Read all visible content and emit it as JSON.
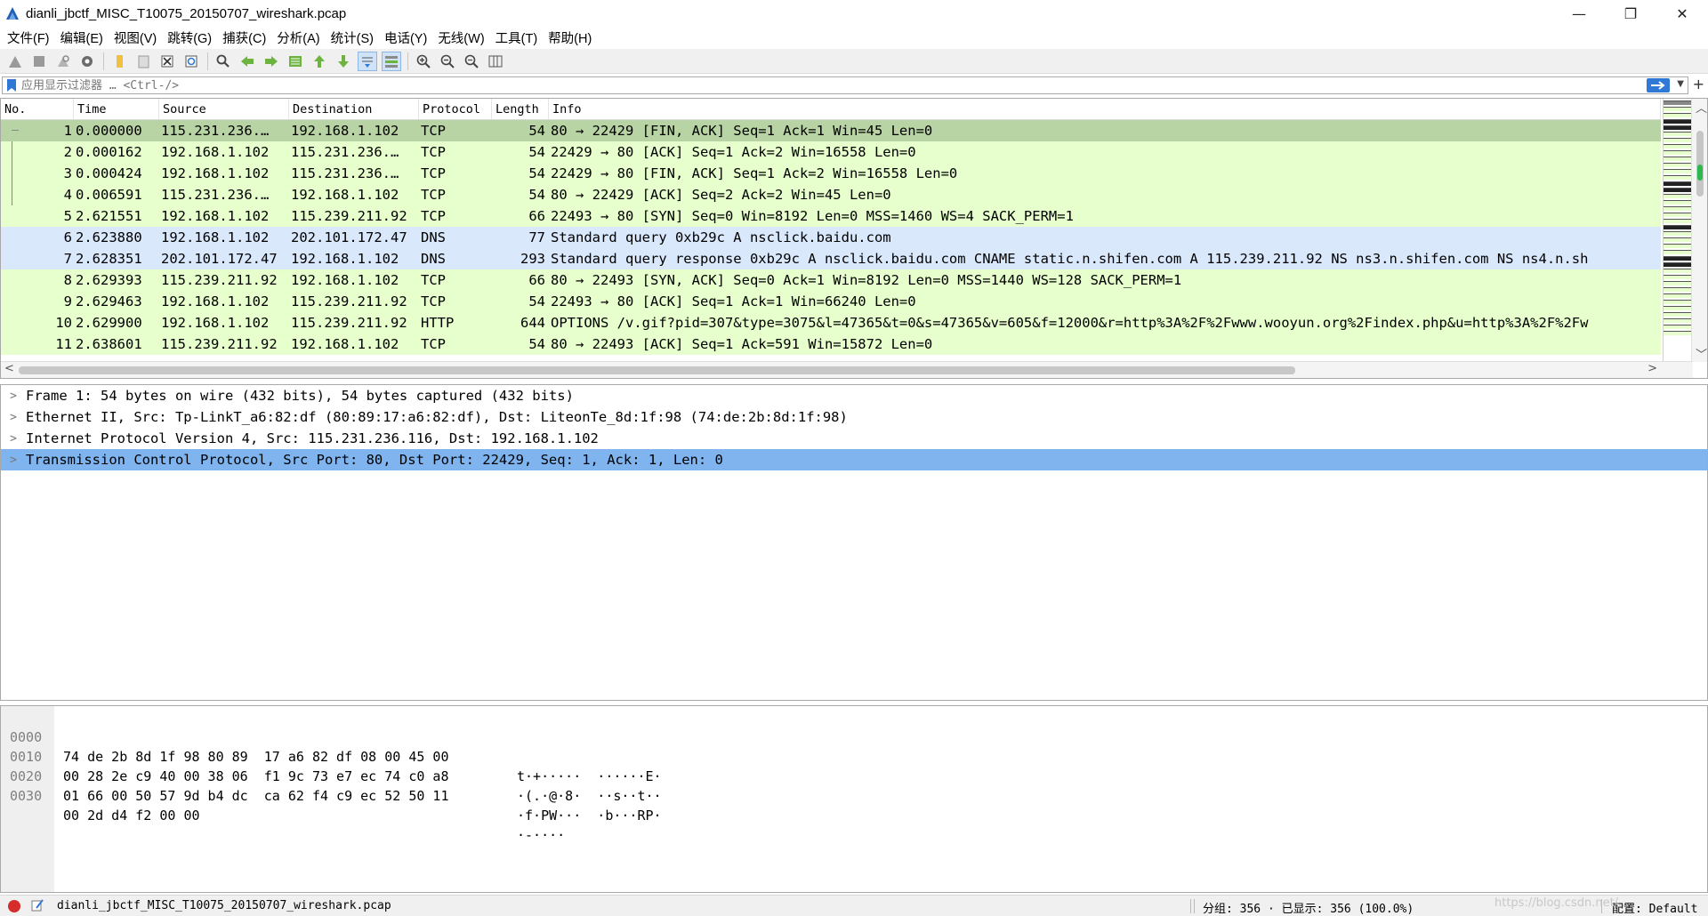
{
  "window": {
    "title": "dianli_jbctf_MISC_T10075_20150707_wireshark.pcap",
    "minimize": "—",
    "restore": "❐",
    "close": "✕"
  },
  "menu": [
    "文件(F)",
    "编辑(E)",
    "视图(V)",
    "跳转(G)",
    "捕获(C)",
    "分析(A)",
    "统计(S)",
    "电话(Y)",
    "无线(W)",
    "工具(T)",
    "帮助(H)"
  ],
  "filter": {
    "placeholder": "应用显示过滤器 … <Ctrl-/>",
    "plus": "+"
  },
  "packet_list": {
    "columns": [
      "No.",
      "Time",
      "Source",
      "Destination",
      "Protocol",
      "Length",
      "Info"
    ],
    "rows": [
      {
        "no": "1",
        "time": "0.000000",
        "src": "115.231.236.…",
        "dst": "192.168.1.102",
        "proto": "TCP",
        "len": "54",
        "info": "80 → 22429 [FIN, ACK] Seq=1 Ack=1 Win=45 Len=0",
        "type": "selected"
      },
      {
        "no": "2",
        "time": "0.000162",
        "src": "192.168.1.102",
        "dst": "115.231.236.…",
        "proto": "TCP",
        "len": "54",
        "info": "22429 → 80 [ACK] Seq=1 Ack=2 Win=16558 Len=0",
        "type": "tcp"
      },
      {
        "no": "3",
        "time": "0.000424",
        "src": "192.168.1.102",
        "dst": "115.231.236.…",
        "proto": "TCP",
        "len": "54",
        "info": "22429 → 80 [FIN, ACK] Seq=1 Ack=2 Win=16558 Len=0",
        "type": "tcp"
      },
      {
        "no": "4",
        "time": "0.006591",
        "src": "115.231.236.…",
        "dst": "192.168.1.102",
        "proto": "TCP",
        "len": "54",
        "info": "80 → 22429 [ACK] Seq=2 Ack=2 Win=45 Len=0",
        "type": "tcp"
      },
      {
        "no": "5",
        "time": "2.621551",
        "src": "192.168.1.102",
        "dst": "115.239.211.92",
        "proto": "TCP",
        "len": "66",
        "info": "22493 → 80 [SYN] Seq=0 Win=8192 Len=0 MSS=1460 WS=4 SACK_PERM=1",
        "type": "tcp"
      },
      {
        "no": "6",
        "time": "2.623880",
        "src": "192.168.1.102",
        "dst": "202.101.172.47",
        "proto": "DNS",
        "len": "77",
        "info": "Standard query 0xb29c A nsclick.baidu.com",
        "type": "dns"
      },
      {
        "no": "7",
        "time": "2.628351",
        "src": "202.101.172.47",
        "dst": "192.168.1.102",
        "proto": "DNS",
        "len": "293",
        "info": "Standard query response 0xb29c A nsclick.baidu.com CNAME static.n.shifen.com A 115.239.211.92 NS ns3.n.shifen.com NS ns4.n.sh",
        "type": "dns"
      },
      {
        "no": "8",
        "time": "2.629393",
        "src": "115.239.211.92",
        "dst": "192.168.1.102",
        "proto": "TCP",
        "len": "66",
        "info": "80 → 22493 [SYN, ACK] Seq=0 Ack=1 Win=8192 Len=0 MSS=1440 WS=128 SACK_PERM=1",
        "type": "tcp"
      },
      {
        "no": "9",
        "time": "2.629463",
        "src": "192.168.1.102",
        "dst": "115.239.211.92",
        "proto": "TCP",
        "len": "54",
        "info": "22493 → 80 [ACK] Seq=1 Ack=1 Win=66240 Len=0",
        "type": "tcp"
      },
      {
        "no": "10",
        "time": "2.629900",
        "src": "192.168.1.102",
        "dst": "115.239.211.92",
        "proto": "HTTP",
        "len": "644",
        "info": "OPTIONS /v.gif?pid=307&type=3075&l=47365&t=0&s=47365&v=605&f=12000&r=http%3A%2F%2Fwww.wooyun.org%2Findex.php&u=http%3A%2F%2Fw",
        "type": "http"
      },
      {
        "no": "11",
        "time": "2.638601",
        "src": "115.239.211.92",
        "dst": "192.168.1.102",
        "proto": "TCP",
        "len": "54",
        "info": "80 → 22493 [ACK] Seq=1 Ack=591 Win=15872 Len=0",
        "type": "tcp"
      }
    ]
  },
  "details": [
    {
      "text": "Frame 1: 54 bytes on wire (432 bits), 54 bytes captured (432 bits)",
      "selected": false
    },
    {
      "text": "Ethernet II, Src: Tp-LinkT_a6:82:df (80:89:17:a6:82:df), Dst: LiteonTe_8d:1f:98 (74:de:2b:8d:1f:98)",
      "selected": false
    },
    {
      "text": "Internet Protocol Version 4, Src: 115.231.236.116, Dst: 192.168.1.102",
      "selected": false
    },
    {
      "text": "Transmission Control Protocol, Src Port: 80, Dst Port: 22429, Seq: 1, Ack: 1, Len: 0",
      "selected": true
    }
  ],
  "bytes": [
    {
      "offset": "0000",
      "hex": "74 de 2b 8d 1f 98 80 89  17 a6 82 df 08 00 45 00",
      "ascii": "t·+·····  ······E·"
    },
    {
      "offset": "0010",
      "hex": "00 28 2e c9 40 00 38 06  f1 9c 73 e7 ec 74 c0 a8",
      "ascii": "·(.·@·8·  ··s··t··"
    },
    {
      "offset": "0020",
      "hex": "01 66 00 50 57 9d b4 dc  ca 62 f4 c9 ec 52 50 11",
      "ascii": "·f·PW···  ·b···RP·"
    },
    {
      "offset": "0030",
      "hex": "00 2d d4 f2 00 00",
      "ascii": "·-····"
    }
  ],
  "status": {
    "file": "dianli_jbctf_MISC_T10075_20150707_wireshark.pcap",
    "packets": "分组: 356 · 已显示: 356 (100.0%)",
    "profile": "配置: Default",
    "watermark": "https://blog.csdn.net/..."
  },
  "colors": {
    "tcp_row": "#e6ffcc",
    "dns_row": "#dae8fc",
    "selected_packet": "#b9d4a4",
    "selected_detail": "#7fb4ef",
    "status_dot": "#d62c2c"
  }
}
